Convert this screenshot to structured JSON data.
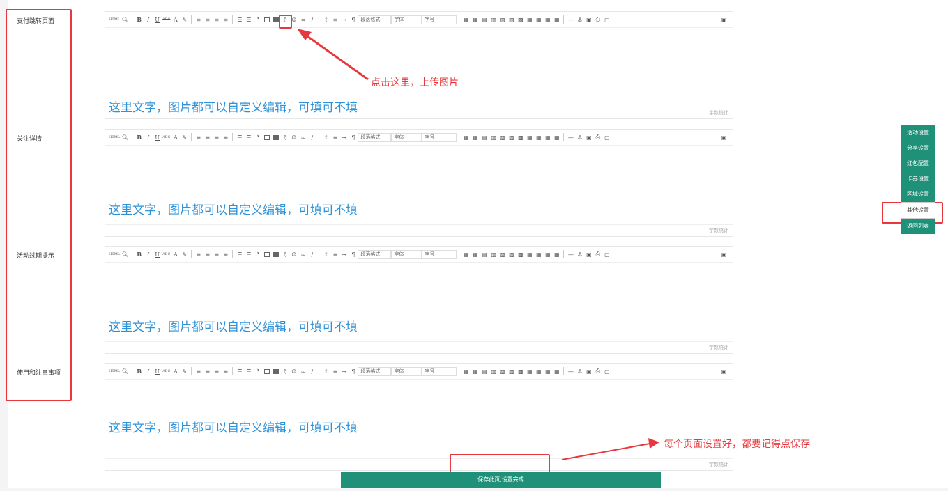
{
  "labels": [
    "支付跳转页面",
    "关注详情",
    "活动过期提示",
    "使用和注意事项"
  ],
  "editor": {
    "hint": "这里文字，图片都可以自定义编辑，可填可不填",
    "word_count": "字数统计",
    "toolbar": {
      "html": "HTML",
      "bold": "B",
      "italic": "I",
      "underline": "U",
      "strike": "ABC",
      "fontcolor": "A",
      "paragraph_format": "段落格式",
      "font_family": "字体",
      "font_size": "字号"
    }
  },
  "annotations": {
    "upload_tip": "点击这里，上传图片",
    "save_tip": "每个页面设置好，都要记得点保存"
  },
  "sidenav": [
    "活动设置",
    "分享设置",
    "红包配置",
    "卡券设置",
    "区域设置",
    "其他设置",
    "返回列表"
  ],
  "sidenav_active": "其他设置",
  "save_button": "保存此页,设置完成",
  "colors": {
    "accent": "#1e9178",
    "hint": "#2e92d8",
    "annotation": "#e8383d"
  }
}
